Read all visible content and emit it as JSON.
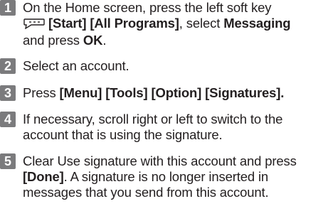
{
  "steps": [
    {
      "number": "1",
      "parts": {
        "a": "On the Home screen, press the left soft key",
        "b": "[Start] [All Programs]",
        "c": ", select ",
        "d": "Messaging",
        "e": "and press ",
        "f": "OK",
        "g": "."
      },
      "icon": "left-soft-key-icon"
    },
    {
      "number": "2",
      "parts": {
        "a": "Select an account."
      }
    },
    {
      "number": "3",
      "parts": {
        "a": "Press ",
        "b": "[Menu] [Tools] [Option] [Signatures]."
      }
    },
    {
      "number": "4",
      "parts": {
        "a": "If necessary, scroll right or left to switch to the",
        "b": "account that is using the signature."
      }
    },
    {
      "number": "5",
      "parts": {
        "a": "Clear Use signature with this account and press",
        "b": "[Done]",
        "c": ". A signature is no longer inserted in",
        "d": "messages that you send from this account."
      }
    }
  ],
  "colors": {
    "badge": "#7b7b7d",
    "text": "#231f20"
  }
}
